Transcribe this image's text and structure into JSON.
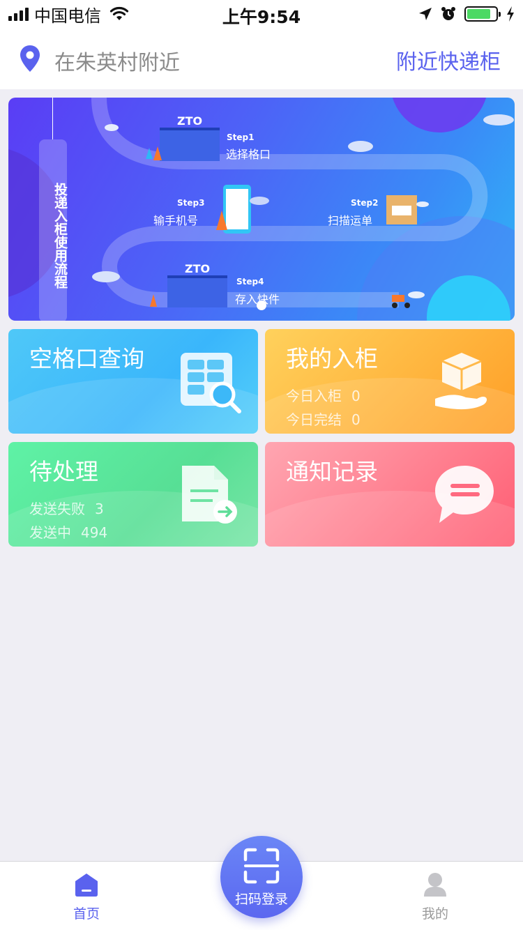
{
  "status_bar": {
    "carrier": "中国电信",
    "time": "上午9:54"
  },
  "header": {
    "location_text": "在朱英村附近",
    "nearby_link": "附近快递柜"
  },
  "banner": {
    "title": "投递入柜使用流程",
    "logo": "ZTO",
    "steps": [
      {
        "num": "Step1",
        "text": "选择格口"
      },
      {
        "num": "Step2",
        "text": "扫描运单"
      },
      {
        "num": "Step3",
        "text": "输手机号"
      },
      {
        "num": "Step4",
        "text": "存入快件"
      }
    ]
  },
  "cards": {
    "empty_slot": {
      "title": "空格口查询",
      "icon": "grid-search-icon"
    },
    "my_deposits": {
      "title": "我的入柜",
      "today_in_label": "今日入柜",
      "today_in_value": "0",
      "today_done_label": "今日完结",
      "today_done_value": "0",
      "icon": "box-hand-icon"
    },
    "pending": {
      "title": "待处理",
      "failed_label": "发送失败",
      "failed_value": "3",
      "sending_label": "发送中",
      "sending_value": "494",
      "icon": "document-arrow-icon"
    },
    "notices": {
      "title": "通知记录",
      "icon": "chat-bubble-icon"
    }
  },
  "tab_bar": {
    "home": "首页",
    "scan": "扫码登录",
    "mine": "我的"
  },
  "colors": {
    "accent": "#5a62ee",
    "page_bg": "#efeef4"
  }
}
